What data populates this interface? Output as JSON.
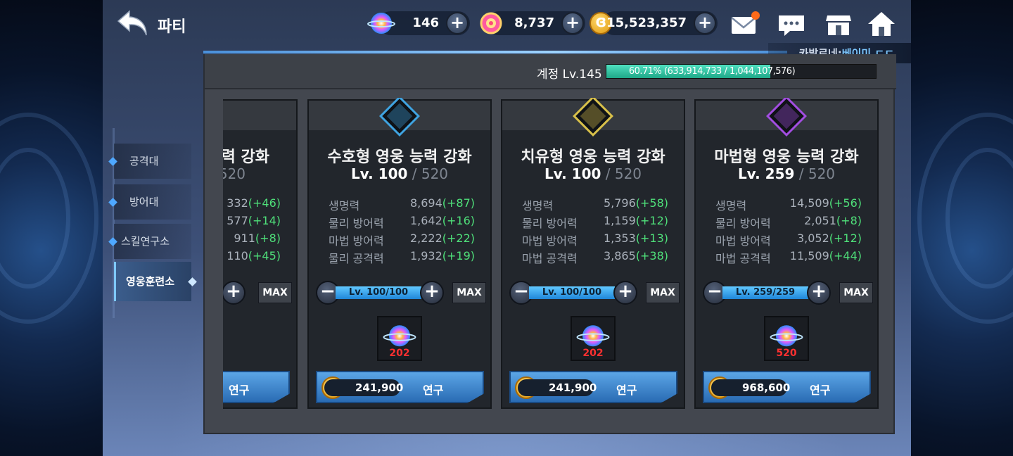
{
  "header": {
    "title": "파티",
    "currencies": [
      {
        "name": "crystal",
        "value": "146"
      },
      {
        "name": "gem",
        "value": "8,737"
      },
      {
        "name": "gold",
        "value": "315,523,357"
      }
    ],
    "gold_symbol": "G",
    "plus": "+"
  },
  "server": {
    "prefix": "카발로네:",
    "nickname": "베이미 ㄷㄷ"
  },
  "account": {
    "label": "계정 Lv.145",
    "exp_text": "60.71% (633,914,733 / 1,044,107,576)",
    "exp_percent": 60.71
  },
  "sidemenu": {
    "items": [
      {
        "label": "공격대"
      },
      {
        "label": "방어대"
      },
      {
        "label": "스킬연구소"
      },
      {
        "label": "영웅훈련소"
      }
    ]
  },
  "partial_card": {
    "name": "력 강화",
    "max_level": "520",
    "stats": [
      "332(+46)",
      "577(+14)",
      "911(+8)",
      "110(+45)"
    ],
    "stat_values": [
      "332",
      "577",
      "911",
      "110"
    ],
    "stat_incs": [
      "(+46)",
      "(+14)",
      "(+8)",
      "(+45)"
    ],
    "max_label": "MAX",
    "research_label": "연구"
  },
  "cards": [
    {
      "name": "수호형 영웅 능력 강화",
      "level": "Lv. 100",
      "max_level": "/ 520",
      "emblem_color": "#3fa3e0",
      "stats": [
        {
          "name": "생명력",
          "value": "8,694",
          "inc": "(+87)"
        },
        {
          "name": "물리 방어력",
          "value": "1,642",
          "inc": "(+16)"
        },
        {
          "name": "마법 방어력",
          "value": "2,222",
          "inc": "(+22)"
        },
        {
          "name": "물리 공격력",
          "value": "1,932",
          "inc": "(+19)"
        }
      ],
      "bar_label": "Lv. 100/100",
      "bar_fraction": 1.0,
      "max_label": "MAX",
      "material_count": "202",
      "cost": "241,900",
      "research_label": "연구"
    },
    {
      "name": "치유형 영웅 능력 강화",
      "level": "Lv. 100",
      "max_level": "/ 520",
      "emblem_color": "#d9c14a",
      "stats": [
        {
          "name": "생명력",
          "value": "5,796",
          "inc": "(+58)"
        },
        {
          "name": "물리 방어력",
          "value": "1,159",
          "inc": "(+12)"
        },
        {
          "name": "마법 방어력",
          "value": "1,353",
          "inc": "(+13)"
        },
        {
          "name": "마법 공격력",
          "value": "3,865",
          "inc": "(+38)"
        }
      ],
      "bar_label": "Lv. 100/100",
      "bar_fraction": 1.0,
      "max_label": "MAX",
      "material_count": "202",
      "cost": "241,900",
      "research_label": "연구"
    },
    {
      "name": "마법형 영웅 능력 강화",
      "level": "Lv. 259",
      "max_level": "/ 520",
      "emblem_color": "#a24de0",
      "stats": [
        {
          "name": "생명력",
          "value": "14,509",
          "inc": "(+56)"
        },
        {
          "name": "물리 방어력",
          "value": "2,051",
          "inc": "(+8)"
        },
        {
          "name": "마법 방어력",
          "value": "3,052",
          "inc": "(+12)"
        },
        {
          "name": "마법 공격력",
          "value": "11,509",
          "inc": "(+44)"
        }
      ],
      "bar_label": "Lv. 259/259",
      "bar_fraction": 1.0,
      "max_label": "MAX",
      "material_count": "520",
      "cost": "968,600",
      "research_label": "연구"
    }
  ],
  "controls": {
    "minus": "−",
    "plus": "+"
  }
}
